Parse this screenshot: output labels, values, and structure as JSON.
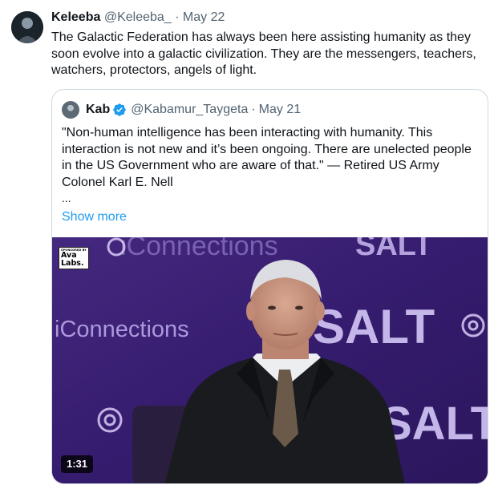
{
  "post": {
    "author_name": "Keleeba",
    "author_handle": "@Keleeba_",
    "separator": "·",
    "date": "May 22",
    "text": "The Galactic Federation has always been here assisting humanity as they soon evolve into a galactic civilization. They are the messengers, teachers, watchers, protectors, angels of light."
  },
  "quote": {
    "author_name": "Kab",
    "author_handle": "@Kabamur_Taygeta",
    "separator": "·",
    "date": "May 21",
    "text": "\"Non-human intelligence has been interacting with humanity. This interaction is not new and it’s been ongoing. There are unelected people in the US Government who are aware of that.\" — Retired US Army Colonel Karl E. Nell",
    "ellipsis": "...",
    "show_more": "Show more",
    "video": {
      "duration": "1:31",
      "sponsor_top": "SPONSORED BY",
      "sponsor_line1": "Ava",
      "sponsor_line2": "Labs.",
      "backdrop_brand_1": "iConnections",
      "backdrop_brand_2": "SALT"
    }
  },
  "colors": {
    "link": "#1d9bf0",
    "verified": "#1d9bf0",
    "backdrop": "#3a2177"
  },
  "icons": [
    "author-avatar",
    "quote-author-avatar",
    "verified-badge-icon"
  ]
}
